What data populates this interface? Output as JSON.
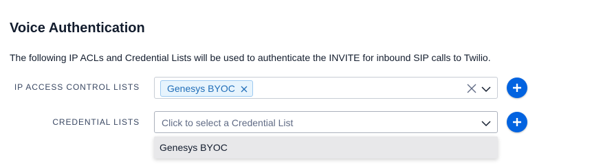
{
  "section": {
    "title": "Voice Authentication",
    "description": "The following IP ACLs and Credential Lists will be used to authenticate the INVITE for inbound SIP calls to Twilio."
  },
  "ip_acl": {
    "label": "IP ACCESS CONTROL LISTS",
    "selected_chip": "Genesys BYOC",
    "chip_close_icon": "close-icon",
    "clear_icon": "clear-icon",
    "chevron_icon": "chevron-down-icon",
    "add_icon": "plus-icon"
  },
  "credential_lists": {
    "label": "CREDENTIAL LISTS",
    "placeholder": "Click to select a Credential List",
    "chevron_icon": "chevron-down-icon",
    "add_icon": "plus-icon",
    "dropdown_options": [
      "Genesys BYOC"
    ]
  },
  "colors": {
    "accent": "#0263e0",
    "chip_background": "#e7f4fd",
    "chip_text": "#1f6db8",
    "dropdown_highlight": "#e8e8ea"
  }
}
